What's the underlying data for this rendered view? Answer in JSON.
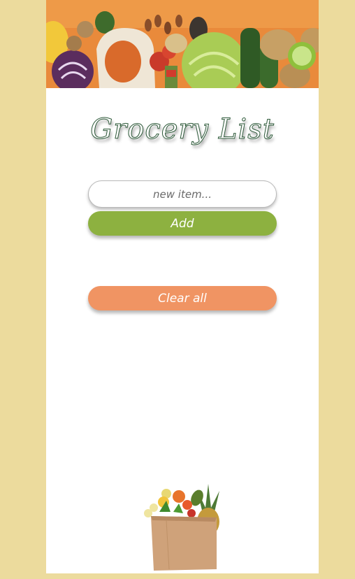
{
  "app": {
    "title": "Grocery List"
  },
  "form": {
    "input_placeholder": "new item...",
    "input_value": "",
    "add_label": "Add",
    "clear_label": "Clear all"
  },
  "list": {
    "items": []
  },
  "colors": {
    "background": "#ecdb9d",
    "card": "#ffffff",
    "add_button": "#8db140",
    "clear_button": "#f09463",
    "title_outline": "#2e5a3a"
  },
  "icons": {
    "hero": "vegetables-banner-icon",
    "bag": "grocery-bag-icon"
  }
}
